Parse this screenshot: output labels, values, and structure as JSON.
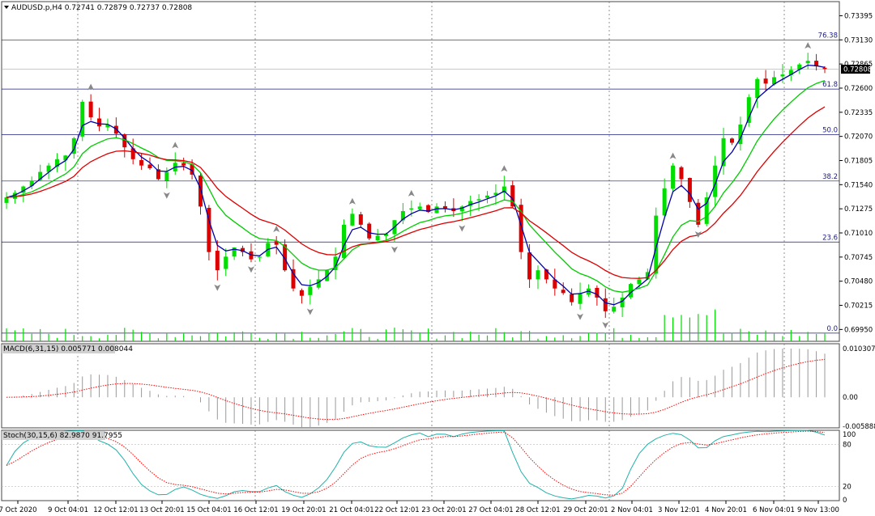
{
  "header": {
    "symbol_line": "AUDUSD.p,H4  0.72741 0.72879 0.72737 0.72808"
  },
  "main_panel": {
    "y_min": 0.6982,
    "y_max": 0.7355,
    "tick_labels": [
      "0.73395",
      "0.73130",
      "0.72865",
      "0.72600",
      "0.72335",
      "0.72070",
      "0.71805",
      "0.71540",
      "0.71275",
      "0.71010",
      "0.70745",
      "0.70480",
      "0.70215",
      "0.69950"
    ],
    "current_price": "0.72808",
    "fib_levels": [
      {
        "label": "76.38",
        "price": 0.7313
      },
      {
        "label": "61.8",
        "price": 0.7259
      },
      {
        "label": "50.0",
        "price": 0.7209
      },
      {
        "label": "38.2",
        "price": 0.7158
      },
      {
        "label": "23.6",
        "price": 0.7091
      },
      {
        "label": "0.0",
        "price": 0.6991
      }
    ]
  },
  "macd_panel": {
    "label": "MACD(6,31,15) 0.005771 0.008044",
    "y_max": 0.010307,
    "y_min": -0.005888,
    "tick_labels": [
      "0.010307",
      "0.00",
      "-0.005888"
    ]
  },
  "stoch_panel": {
    "label": "Stoch(30,15,6) 82.9870 91.7955",
    "tick_labels": [
      "100",
      "80",
      "20",
      "0"
    ]
  },
  "x_axis": {
    "labels": [
      "7 Oct 2020",
      "9 Oct 04:01",
      "12 Oct 12:01",
      "13 Oct 20:01",
      "15 Oct 04:01",
      "16 Oct 12:01",
      "19 Oct 20:01",
      "21 Oct 04:01",
      "22 Oct 12:01",
      "23 Oct 20:01",
      "27 Oct 04:01",
      "28 Oct 12:01",
      "29 Oct 20:01",
      "2 Nov 04:01",
      "3 Nov 12:01",
      "4 Nov 20:01",
      "6 Nov 04:01",
      "9 Nov 13:00"
    ]
  },
  "colors": {
    "bull": "#00dd00",
    "bear": "#dd0000",
    "ma_fast": "#0000aa",
    "ma_mid": "#00cc00",
    "ma_slow": "#dd0000",
    "fib": "#1a1a80",
    "grid": "#777777",
    "macd_hist": "#999999",
    "macd_signal": "#ff0000",
    "stoch_main": "#20b2aa",
    "stoch_signal": "#ff0000"
  },
  "chart_data": {
    "type": "candlestick",
    "symbol": "AUDUSD.p",
    "timeframe": "H4",
    "close_path_approx": [
      0.714,
      0.7145,
      0.7152,
      0.7158,
      0.7168,
      0.7175,
      0.7182,
      0.7186,
      0.7205,
      0.7245,
      0.7228,
      0.7218,
      0.722,
      0.721,
      0.7195,
      0.7182,
      0.7175,
      0.7172,
      0.716,
      0.7168,
      0.7178,
      0.7175,
      0.7165,
      0.713,
      0.708,
      0.706,
      0.7075,
      0.7085,
      0.708,
      0.7072,
      0.7075,
      0.709,
      0.7088,
      0.706,
      0.704,
      0.7032,
      0.7042,
      0.705,
      0.706,
      0.7075,
      0.711,
      0.7122,
      0.711,
      0.7095,
      0.7098,
      0.71,
      0.7115,
      0.7125,
      0.7128,
      0.713,
      0.7124,
      0.713,
      0.7128,
      0.7125,
      0.713,
      0.7136,
      0.7138,
      0.7142,
      0.7145,
      0.7152,
      0.713,
      0.708,
      0.705,
      0.706,
      0.705,
      0.704,
      0.7035,
      0.7025,
      0.7035,
      0.704,
      0.703,
      0.7015,
      0.702,
      0.703,
      0.7045,
      0.705,
      0.7058,
      0.712,
      0.715,
      0.7175,
      0.716,
      0.7135,
      0.711,
      0.714,
      0.7175,
      0.7205,
      0.72,
      0.722,
      0.725,
      0.727,
      0.7265,
      0.7272,
      0.7275,
      0.728,
      0.7286,
      0.729,
      0.7284,
      0.7281
    ]
  }
}
